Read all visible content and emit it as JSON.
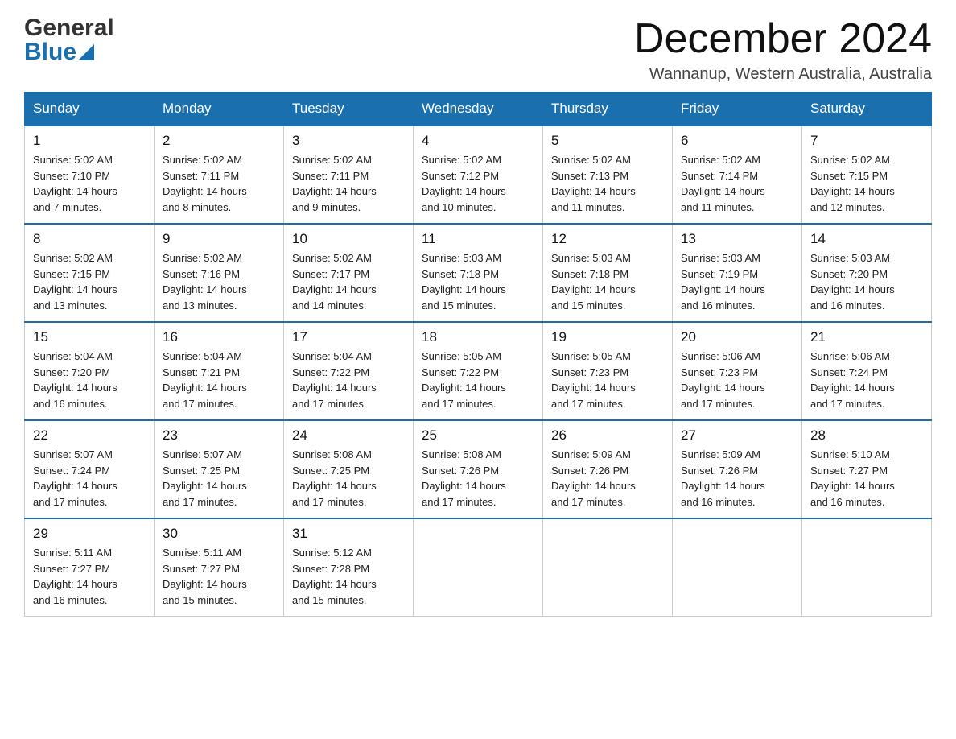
{
  "header": {
    "logo_general": "General",
    "logo_blue": "Blue",
    "month_title": "December 2024",
    "location": "Wannanup, Western Australia, Australia"
  },
  "days_of_week": [
    "Sunday",
    "Monday",
    "Tuesday",
    "Wednesday",
    "Thursday",
    "Friday",
    "Saturday"
  ],
  "weeks": [
    [
      {
        "day": "1",
        "sunrise": "5:02 AM",
        "sunset": "7:10 PM",
        "daylight": "14 hours and 7 minutes."
      },
      {
        "day": "2",
        "sunrise": "5:02 AM",
        "sunset": "7:11 PM",
        "daylight": "14 hours and 8 minutes."
      },
      {
        "day": "3",
        "sunrise": "5:02 AM",
        "sunset": "7:11 PM",
        "daylight": "14 hours and 9 minutes."
      },
      {
        "day": "4",
        "sunrise": "5:02 AM",
        "sunset": "7:12 PM",
        "daylight": "14 hours and 10 minutes."
      },
      {
        "day": "5",
        "sunrise": "5:02 AM",
        "sunset": "7:13 PM",
        "daylight": "14 hours and 11 minutes."
      },
      {
        "day": "6",
        "sunrise": "5:02 AM",
        "sunset": "7:14 PM",
        "daylight": "14 hours and 11 minutes."
      },
      {
        "day": "7",
        "sunrise": "5:02 AM",
        "sunset": "7:15 PM",
        "daylight": "14 hours and 12 minutes."
      }
    ],
    [
      {
        "day": "8",
        "sunrise": "5:02 AM",
        "sunset": "7:15 PM",
        "daylight": "14 hours and 13 minutes."
      },
      {
        "day": "9",
        "sunrise": "5:02 AM",
        "sunset": "7:16 PM",
        "daylight": "14 hours and 13 minutes."
      },
      {
        "day": "10",
        "sunrise": "5:02 AM",
        "sunset": "7:17 PM",
        "daylight": "14 hours and 14 minutes."
      },
      {
        "day": "11",
        "sunrise": "5:03 AM",
        "sunset": "7:18 PM",
        "daylight": "14 hours and 15 minutes."
      },
      {
        "day": "12",
        "sunrise": "5:03 AM",
        "sunset": "7:18 PM",
        "daylight": "14 hours and 15 minutes."
      },
      {
        "day": "13",
        "sunrise": "5:03 AM",
        "sunset": "7:19 PM",
        "daylight": "14 hours and 16 minutes."
      },
      {
        "day": "14",
        "sunrise": "5:03 AM",
        "sunset": "7:20 PM",
        "daylight": "14 hours and 16 minutes."
      }
    ],
    [
      {
        "day": "15",
        "sunrise": "5:04 AM",
        "sunset": "7:20 PM",
        "daylight": "14 hours and 16 minutes."
      },
      {
        "day": "16",
        "sunrise": "5:04 AM",
        "sunset": "7:21 PM",
        "daylight": "14 hours and 17 minutes."
      },
      {
        "day": "17",
        "sunrise": "5:04 AM",
        "sunset": "7:22 PM",
        "daylight": "14 hours and 17 minutes."
      },
      {
        "day": "18",
        "sunrise": "5:05 AM",
        "sunset": "7:22 PM",
        "daylight": "14 hours and 17 minutes."
      },
      {
        "day": "19",
        "sunrise": "5:05 AM",
        "sunset": "7:23 PM",
        "daylight": "14 hours and 17 minutes."
      },
      {
        "day": "20",
        "sunrise": "5:06 AM",
        "sunset": "7:23 PM",
        "daylight": "14 hours and 17 minutes."
      },
      {
        "day": "21",
        "sunrise": "5:06 AM",
        "sunset": "7:24 PM",
        "daylight": "14 hours and 17 minutes."
      }
    ],
    [
      {
        "day": "22",
        "sunrise": "5:07 AM",
        "sunset": "7:24 PM",
        "daylight": "14 hours and 17 minutes."
      },
      {
        "day": "23",
        "sunrise": "5:07 AM",
        "sunset": "7:25 PM",
        "daylight": "14 hours and 17 minutes."
      },
      {
        "day": "24",
        "sunrise": "5:08 AM",
        "sunset": "7:25 PM",
        "daylight": "14 hours and 17 minutes."
      },
      {
        "day": "25",
        "sunrise": "5:08 AM",
        "sunset": "7:26 PM",
        "daylight": "14 hours and 17 minutes."
      },
      {
        "day": "26",
        "sunrise": "5:09 AM",
        "sunset": "7:26 PM",
        "daylight": "14 hours and 17 minutes."
      },
      {
        "day": "27",
        "sunrise": "5:09 AM",
        "sunset": "7:26 PM",
        "daylight": "14 hours and 16 minutes."
      },
      {
        "day": "28",
        "sunrise": "5:10 AM",
        "sunset": "7:27 PM",
        "daylight": "14 hours and 16 minutes."
      }
    ],
    [
      {
        "day": "29",
        "sunrise": "5:11 AM",
        "sunset": "7:27 PM",
        "daylight": "14 hours and 16 minutes."
      },
      {
        "day": "30",
        "sunrise": "5:11 AM",
        "sunset": "7:27 PM",
        "daylight": "14 hours and 15 minutes."
      },
      {
        "day": "31",
        "sunrise": "5:12 AM",
        "sunset": "7:28 PM",
        "daylight": "14 hours and 15 minutes."
      },
      null,
      null,
      null,
      null
    ]
  ],
  "labels": {
    "sunrise": "Sunrise:",
    "sunset": "Sunset:",
    "daylight": "Daylight:"
  }
}
